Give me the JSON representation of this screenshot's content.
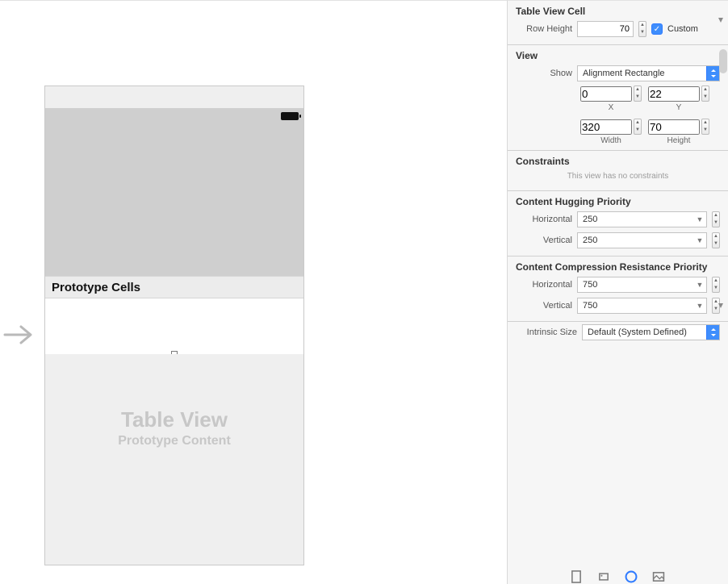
{
  "canvas": {
    "prototype_header": "Prototype Cells",
    "tv_placeholder_title": "Table View",
    "tv_placeholder_subtitle": "Prototype Content"
  },
  "inspector": {
    "table_view_cell": {
      "title": "Table View Cell",
      "row_height_label": "Row Height",
      "row_height_value": "70",
      "custom_label": "Custom"
    },
    "view": {
      "title": "View",
      "show_label": "Show",
      "show_value": "Alignment Rectangle",
      "x_value": "0",
      "x_label": "X",
      "y_value": "22",
      "y_label": "Y",
      "width_value": "320",
      "width_label": "Width",
      "height_value": "70",
      "height_label": "Height"
    },
    "constraints": {
      "title": "Constraints",
      "hint": "This view has no constraints"
    },
    "hugging": {
      "title": "Content Hugging Priority",
      "horizontal_label": "Horizontal",
      "horizontal_value": "250",
      "vertical_label": "Vertical",
      "vertical_value": "250"
    },
    "compression": {
      "title": "Content Compression Resistance Priority",
      "horizontal_label": "Horizontal",
      "horizontal_value": "750",
      "vertical_label": "Vertical",
      "vertical_value": "750"
    },
    "intrinsic": {
      "label": "Intrinsic Size",
      "value": "Default (System Defined)"
    }
  }
}
